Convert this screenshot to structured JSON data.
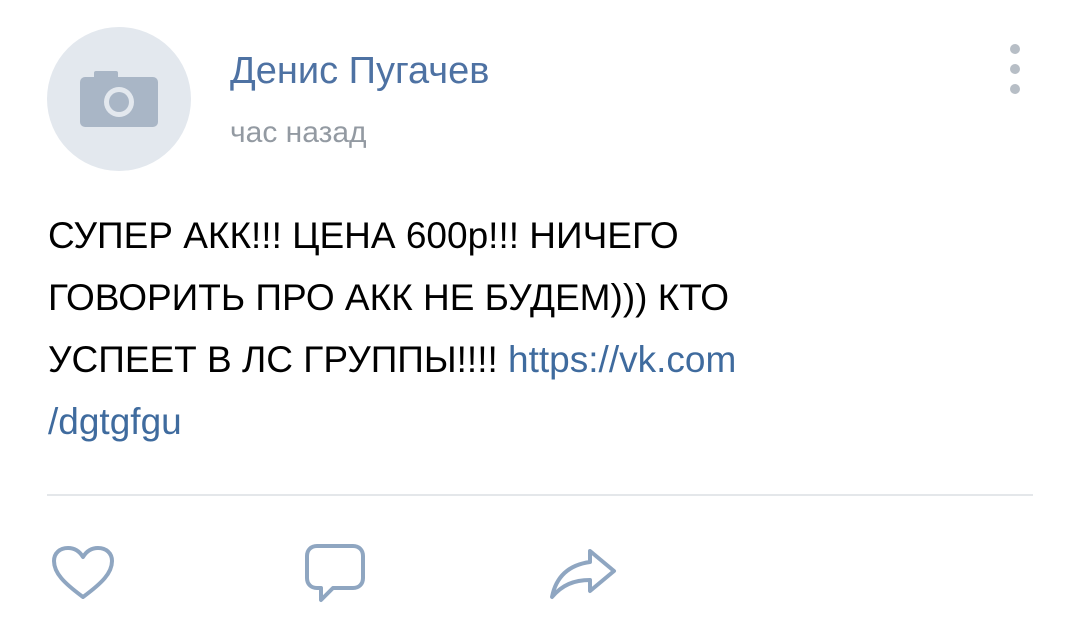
{
  "post": {
    "author_name": "Денис Пугачев",
    "time": "час назад",
    "text_lines": [
      "СУПЕР АКК!!! ЦЕНА 600р!!! НИЧЕГО",
      "ГОВОРИТЬ ПРО АКК НЕ БУДЕМ))) КТО",
      "УСПЕЕТ В ЛС ГРУППЫ!!!! "
    ],
    "link_part1": "https://vk.com",
    "link_part2": "/dgtgfgu"
  },
  "icons": {
    "avatar_placeholder": "camera-icon",
    "menu": "more-vertical-icon",
    "like": "heart-icon",
    "comment": "comment-icon",
    "share": "share-icon"
  },
  "colors": {
    "author": "#4e72a3",
    "link": "#3f6b9e",
    "muted": "#939aa2",
    "icon": "#8fa6c1",
    "avatar_bg": "#e3e8ee",
    "camera": "#a9b6c6"
  }
}
